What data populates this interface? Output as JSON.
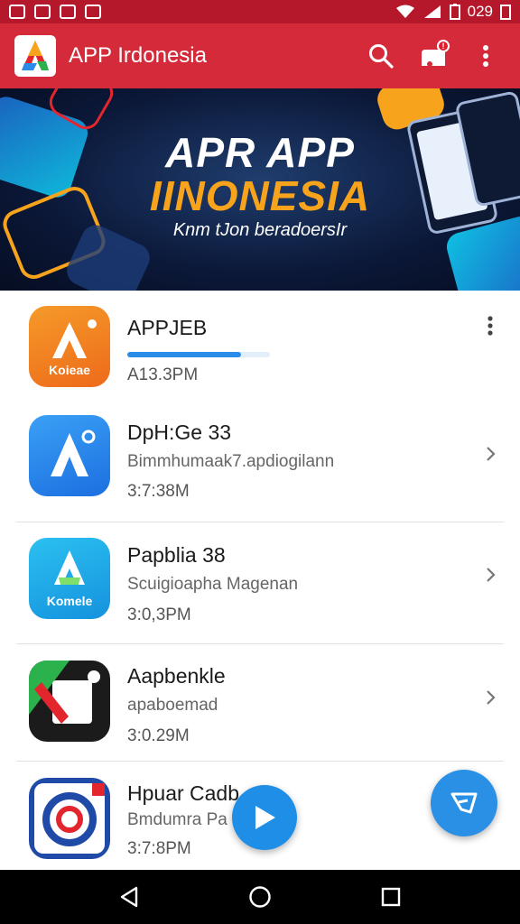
{
  "status_bar": {
    "time": "029"
  },
  "app_bar": {
    "title": "APP Irdonesia"
  },
  "banner": {
    "title_line1": "APR APP",
    "title_line2": "IINONESIA",
    "subtitle": "Knm tJon beradoersIr"
  },
  "apps": [
    {
      "name": "APPJEB",
      "logo_text": "Koieae",
      "size": "A13.3PM",
      "progress": 0.8,
      "accent": "#f07a1c"
    },
    {
      "name": "DpH:Ge 33",
      "desc": "Bimmhumaak7.apdiogilann",
      "size": "3:7:38M",
      "accent": "#2a8be8"
    },
    {
      "name": "Papblia 38",
      "logo_text": "Komele",
      "desc": "Scuigioapha Magenan",
      "size": "3:0,3PM",
      "accent": "#1aa3e8"
    },
    {
      "name": "Aapbenkle",
      "desc": "apaboemad",
      "size": "3:0.29M",
      "accent": "#2bb24c"
    },
    {
      "name": "Hpuar Cadb",
      "desc": "Bmdumra Pa lann",
      "size": "3:7:8PM",
      "accent": "#1f4aa8"
    }
  ],
  "colors": {
    "app_bar": "#d42a3a",
    "status_bar": "#b5182a",
    "fab": "#1e8ee6",
    "progress": "#2a8be8"
  },
  "icons": {
    "search": "search-icon",
    "notifications": "notification-icon",
    "more": "more-vertical-icon",
    "chevron": "chevron-right-icon",
    "play": "play-icon",
    "fab_right": "send-icon",
    "nav_back": "back-triangle-icon",
    "nav_home": "home-circle-icon",
    "nav_recent": "recent-square-icon"
  }
}
